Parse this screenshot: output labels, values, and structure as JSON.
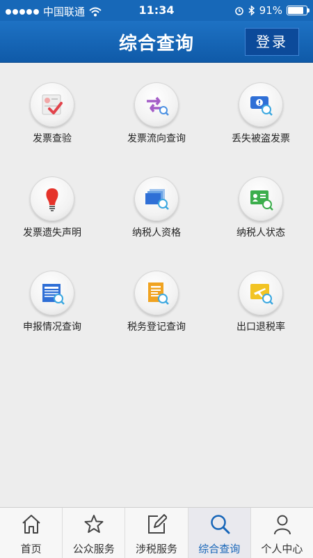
{
  "status_bar": {
    "carrier": "中国联通",
    "time": "11:34",
    "battery": "91%",
    "battery_level": 0.91
  },
  "header": {
    "title": "综合查询",
    "login_label": "登录"
  },
  "menu": [
    {
      "label": "发票查验",
      "icon": "invoice-check-icon"
    },
    {
      "label": "发票流向查询",
      "icon": "invoice-flow-icon"
    },
    {
      "label": "丢失被盗发票",
      "icon": "lost-invoice-icon"
    },
    {
      "label": "发票遗失声明",
      "icon": "lost-declaration-icon"
    },
    {
      "label": "纳税人资格",
      "icon": "taxpayer-qualification-icon"
    },
    {
      "label": "纳税人状态",
      "icon": "taxpayer-status-icon"
    },
    {
      "label": "申报情况查询",
      "icon": "declaration-query-icon"
    },
    {
      "label": "税务登记查询",
      "icon": "tax-registration-icon"
    },
    {
      "label": "出口退税率",
      "icon": "export-rebate-icon"
    }
  ],
  "tab_bar": [
    {
      "label": "首页",
      "icon": "home-icon"
    },
    {
      "label": "公众服务",
      "icon": "star-icon"
    },
    {
      "label": "涉税服务",
      "icon": "edit-icon"
    },
    {
      "label": "综合查询",
      "icon": "search-icon",
      "active": true
    },
    {
      "label": "个人中心",
      "icon": "user-icon"
    }
  ],
  "colors": {
    "primary": "#1665b8",
    "background": "#ededed"
  }
}
